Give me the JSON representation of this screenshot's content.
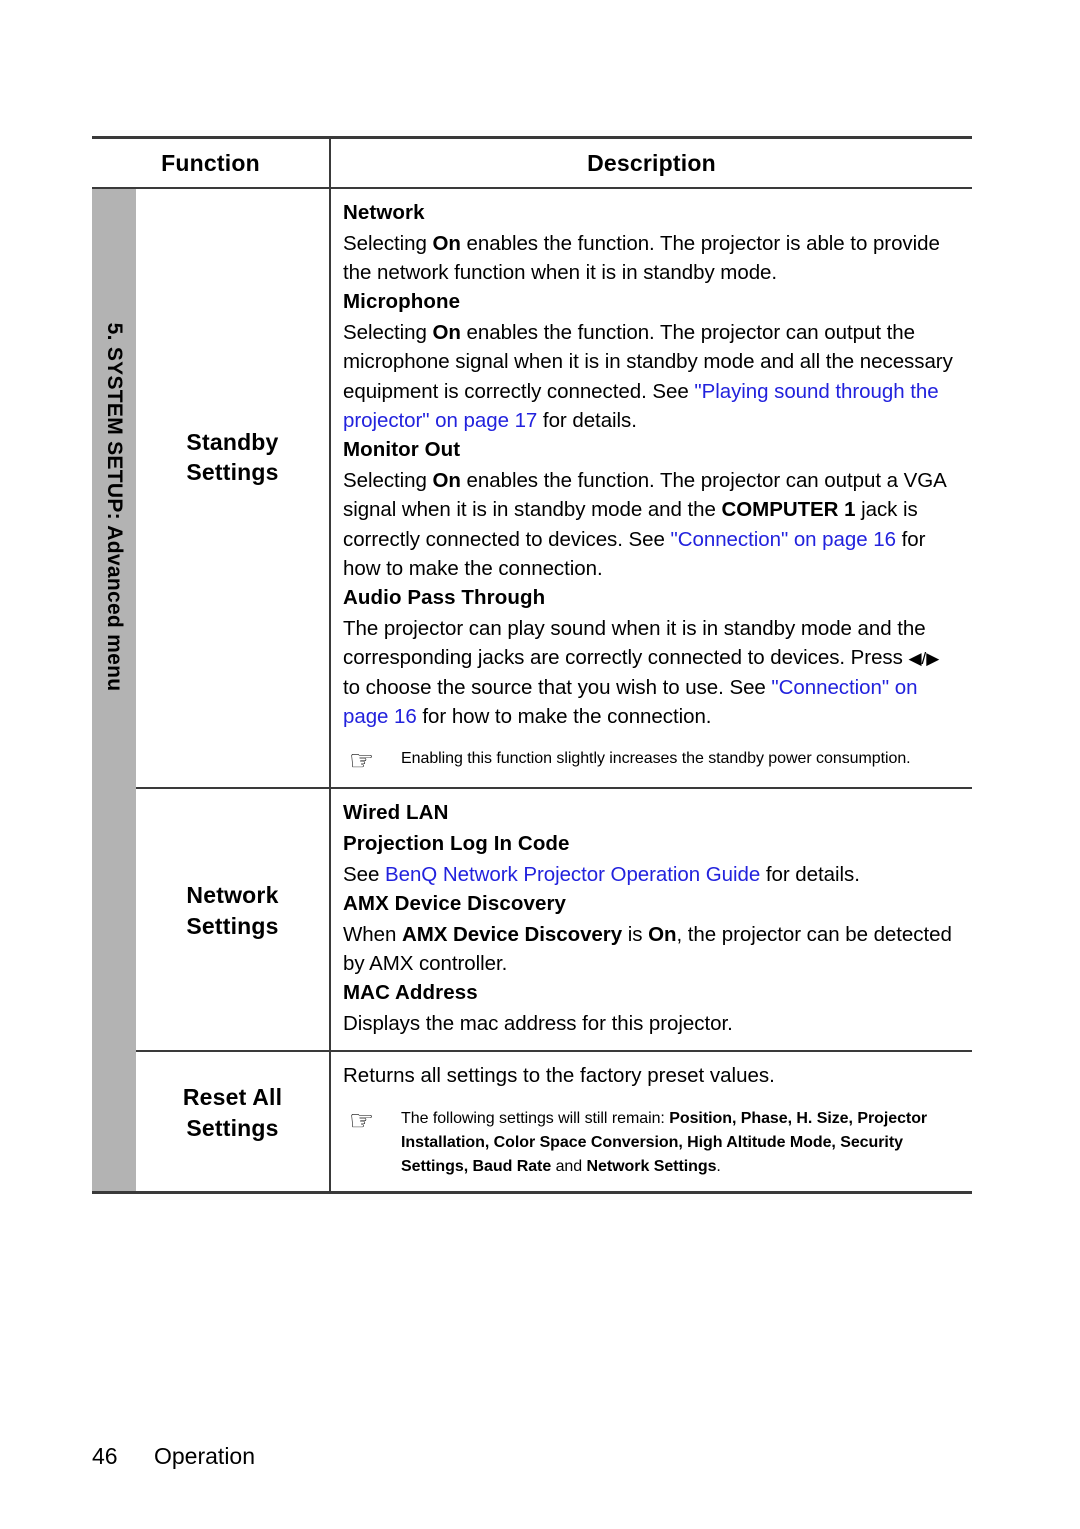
{
  "page": {
    "number": "46",
    "section": "Operation",
    "chapter_tab": "5. SYSTEM SETUP: Advanced menu"
  },
  "table": {
    "headers": {
      "function": "Function",
      "description": "Description"
    },
    "rows": [
      {
        "function": "Standby\nSettings",
        "function_line1": "Standby",
        "function_line2": "Settings",
        "blocks": [
          {
            "title": "Network",
            "body_1": "Selecting ",
            "body_bold_1": "On",
            "body_2": " enables the function. The projector is able to provide the network function when it is in standby mode."
          },
          {
            "title": "Microphone",
            "body_1": "Selecting ",
            "body_bold_1": "On",
            "body_2": " enables the function. The projector can output the microphone signal when it is in standby mode and all the necessary equipment is correctly connected. See ",
            "link": "\"Playing sound through the projector\" on page 17",
            "body_3": " for details."
          },
          {
            "title": "Monitor Out",
            "body_1": "Selecting ",
            "body_bold_1": "On",
            "body_2": " enables the function. The projector can output a VGA signal when it is in standby mode and the ",
            "body_bold_2": "COMPUTER 1",
            "body_3": " jack is correctly connected to devices. See ",
            "link": "\"Connection\" on page 16",
            "body_4": " for how to make the connection."
          },
          {
            "title": "Audio Pass Through",
            "body_1": "The projector can play sound when it is in standby mode and the corresponding jacks are correctly connected to devices. Press ",
            "arrows": "◀/▶",
            "body_2": " to choose the source that you wish to use. See ",
            "link": "\"Connection\" on page 16",
            "body_3": " for how to make the connection."
          }
        ],
        "note": {
          "icon": "pointing-hand-icon",
          "glyph": "☞",
          "text": "Enabling this function slightly increases the standby power consumption."
        }
      },
      {
        "function_line1": "Network",
        "function_line2": "Settings",
        "blocks": [
          {
            "title": "Wired LAN"
          },
          {
            "title": "Projection Log In Code",
            "body_1": "See ",
            "link": "BenQ Network Projector Operation Guide",
            "body_2": " for details."
          },
          {
            "title": "AMX Device Discovery",
            "body_1": "When ",
            "body_bold_1": "AMX Device Discovery",
            "body_2": " is ",
            "body_bold_2": "On",
            "body_3": ", the projector can be detected by AMX controller."
          },
          {
            "title": "MAC Address",
            "body_1": "Displays the mac address for this projector."
          }
        ]
      },
      {
        "function_line1": "Reset All",
        "function_line2": "Settings",
        "intro": "Returns all settings to the factory preset values.",
        "note": {
          "icon": "pointing-hand-icon",
          "glyph": "☞",
          "prefix": "The following settings will still remain: ",
          "items_bold": "Position, Phase, H. Size, Projector Installation, Color Space Conversion, High Altitude Mode, Security Settings, Baud Rate",
          "conj": " and ",
          "last_bold": "Network Settings",
          "suffix": "."
        }
      }
    ]
  },
  "colors": {
    "link": "#2222dd",
    "tab_gray": "#b3b3b3",
    "rule": "#3a3a3a"
  }
}
